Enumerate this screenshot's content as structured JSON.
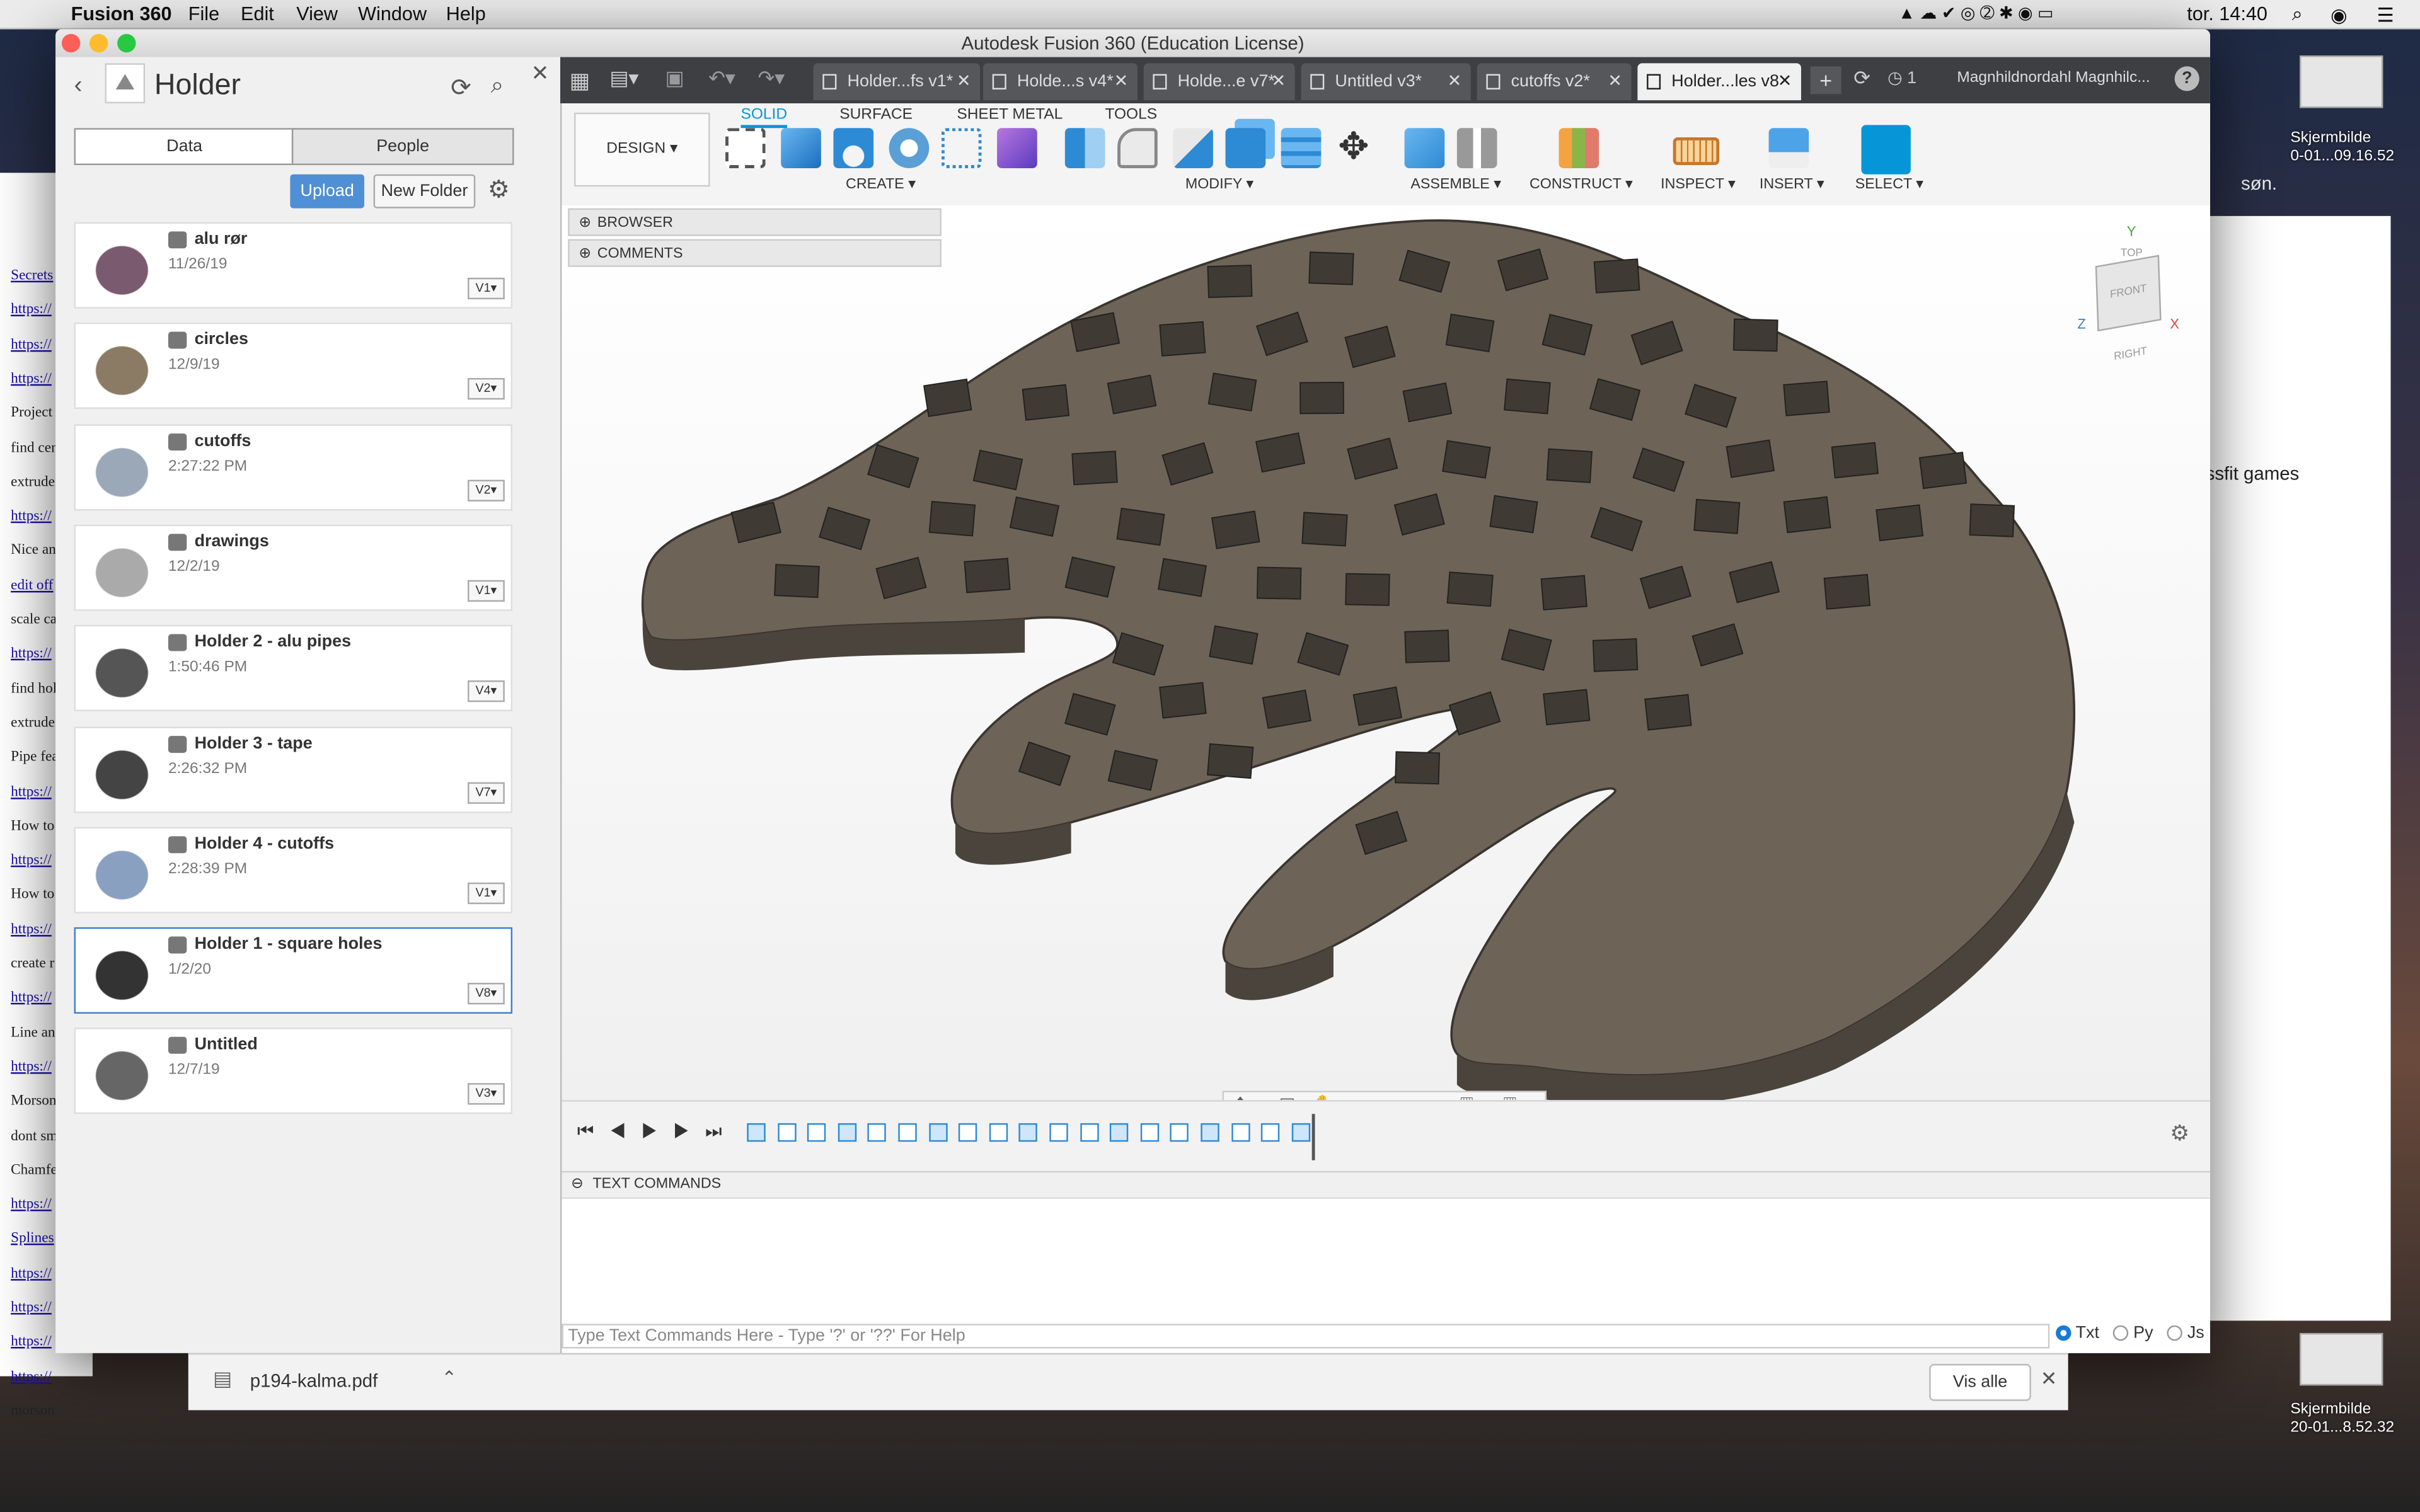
{
  "menubar": {
    "app": "Fusion 360",
    "items": [
      "File",
      "Edit",
      "View",
      "Window",
      "Help"
    ],
    "clock": "tor. 14:40"
  },
  "window": {
    "title": "Autodesk Fusion 360 (Education License)"
  },
  "tabs": [
    {
      "label": "Holder...fs v1*",
      "active": false
    },
    {
      "label": "Holde...s v4*",
      "active": false
    },
    {
      "label": "Holde...e v7*",
      "active": false
    },
    {
      "label": "Untitled v3*",
      "active": false
    },
    {
      "label": "cutoffs v2*",
      "active": false
    },
    {
      "label": "Holder...les v8",
      "active": true
    }
  ],
  "topright": {
    "jobs_count": "1",
    "user": "Magnhildnordahl Magnhilc..."
  },
  "data_panel": {
    "project": "Holder",
    "tab_data": "Data",
    "tab_people": "People",
    "upload_label": "Upload",
    "new_folder_label": "New Folder",
    "files": [
      {
        "name": "alu rør",
        "date": "11/26/19",
        "version": "V1"
      },
      {
        "name": "circles",
        "date": "12/9/19",
        "version": "V2"
      },
      {
        "name": "cutoffs",
        "date": "2:27:22 PM",
        "version": "V2"
      },
      {
        "name": "drawings",
        "date": "12/2/19",
        "version": "V1"
      },
      {
        "name": "Holder 2 - alu pipes",
        "date": "1:50:46 PM",
        "version": "V4"
      },
      {
        "name": "Holder 3 - tape",
        "date": "2:26:32 PM",
        "version": "V7"
      },
      {
        "name": "Holder 4 - cutoffs",
        "date": "2:28:39 PM",
        "version": "V1"
      },
      {
        "name": "Holder 1 - square holes",
        "date": "1/2/20",
        "version": "V8"
      },
      {
        "name": "Untitled",
        "date": "12/7/19",
        "version": "V3"
      }
    ]
  },
  "ribbon": {
    "workspace": "DESIGN",
    "tabs": [
      "SOLID",
      "SURFACE",
      "SHEET METAL",
      "TOOLS"
    ],
    "groups": [
      "CREATE",
      "MODIFY",
      "ASSEMBLE",
      "CONSTRUCT",
      "INSPECT",
      "INSERT",
      "SELECT"
    ]
  },
  "browser": {
    "browser_label": "BROWSER",
    "comments_label": "COMMENTS"
  },
  "viewcube": {
    "top": "TOP",
    "front": "FRONT",
    "right": "RIGHT"
  },
  "text_commands": {
    "header": "TEXT COMMANDS",
    "placeholder": "Type Text Commands Here - Type '?' or '??' For Help",
    "modes": [
      "Txt",
      "Py",
      "Js"
    ],
    "selected_mode": "Txt"
  },
  "download_bar": {
    "file": "p194-kalma.pdf",
    "show_all": "Vis alle"
  },
  "desktop": {
    "shot1_line1": "Skjermbilde",
    "shot1_line2": "0-01...09.16.52",
    "shot2_line1": "Skjermbilde",
    "shot2_line2": "20-01...8.52.32",
    "right_text": "ssfit games",
    "right_son": "søn."
  },
  "bg_doc": {
    "lines": [
      "Secrets",
      "https://",
      "https://",
      "https://",
      "Project",
      "find cen",
      "extrude",
      "https://",
      "Nice an",
      "edit off",
      "scale ca",
      "https://",
      "find hol",
      "extrude",
      "Pipe fea",
      "https://",
      "How to",
      "https://",
      "How to",
      "https://",
      "create r",
      "https://",
      "Line an",
      "https://",
      "Morson",
      "dont sm",
      "Chamfe",
      "https://",
      "Splines",
      "https://",
      "https://",
      "https://",
      "https://",
      "morson"
    ]
  }
}
